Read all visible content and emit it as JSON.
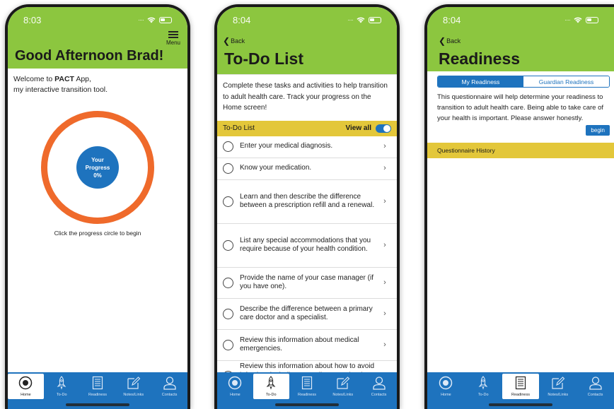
{
  "colors": {
    "header_green": "#8cc63f",
    "primary_blue": "#1e73be",
    "progress_orange": "#ef6a2b",
    "section_yellow": "#e3c73a"
  },
  "tabs": [
    {
      "label": "Home",
      "icon": "home-radio-icon"
    },
    {
      "label": "To-Do",
      "icon": "rocket-icon"
    },
    {
      "label": "Readiness",
      "icon": "checklist-icon"
    },
    {
      "label": "Notes/Links",
      "icon": "note-edit-icon"
    },
    {
      "label": "Contacts",
      "icon": "person-icon"
    }
  ],
  "home": {
    "time": "8:03",
    "menu_label": "Menu",
    "title": "Good Afternoon Brad!",
    "welcome_prefix": "Welcome to ",
    "welcome_app": "PACT",
    "welcome_suffix": " App,",
    "welcome_line2": "my interactive transition tool.",
    "progress_line1": "Your",
    "progress_line2": "Progress",
    "progress_value": "0%",
    "hint": "Click the progress circle to begin",
    "active_tab": "Home"
  },
  "todo": {
    "time": "8:04",
    "back_label": "Back",
    "title": "To-Do List",
    "intro": "Complete these tasks and activities to help transition to adult health care. Track your progress on the Home screen!",
    "section_label": "To-Do List",
    "view_all_label": "View all",
    "view_all_on": true,
    "items": [
      "Enter your medical diagnosis.",
      "Know your medication.",
      "Learn and then describe the difference between a prescription refill and a renewal.",
      "List any special accommodations that you require because of your health condition.",
      "Provide the name of your case manager (if you have one).",
      "Describe the difference between a primary care doctor and a specialist.",
      "Review this information about medical emergencies.",
      "Review this information about how to avoid infection, including sexually transmitted infection."
    ],
    "active_tab": "To-Do"
  },
  "readiness": {
    "time": "8:04",
    "back_label": "Back",
    "title": "Readiness",
    "segment_my": "My Readiness",
    "segment_guardian": "Guardian Readiness",
    "description": "This questionnaire will help determine your readiness to transition to adult health care. Being able to take care of your health is important. Please answer honestly.",
    "begin_label": "begin",
    "history_label": "Questionnaire History",
    "active_tab": "Readiness"
  }
}
